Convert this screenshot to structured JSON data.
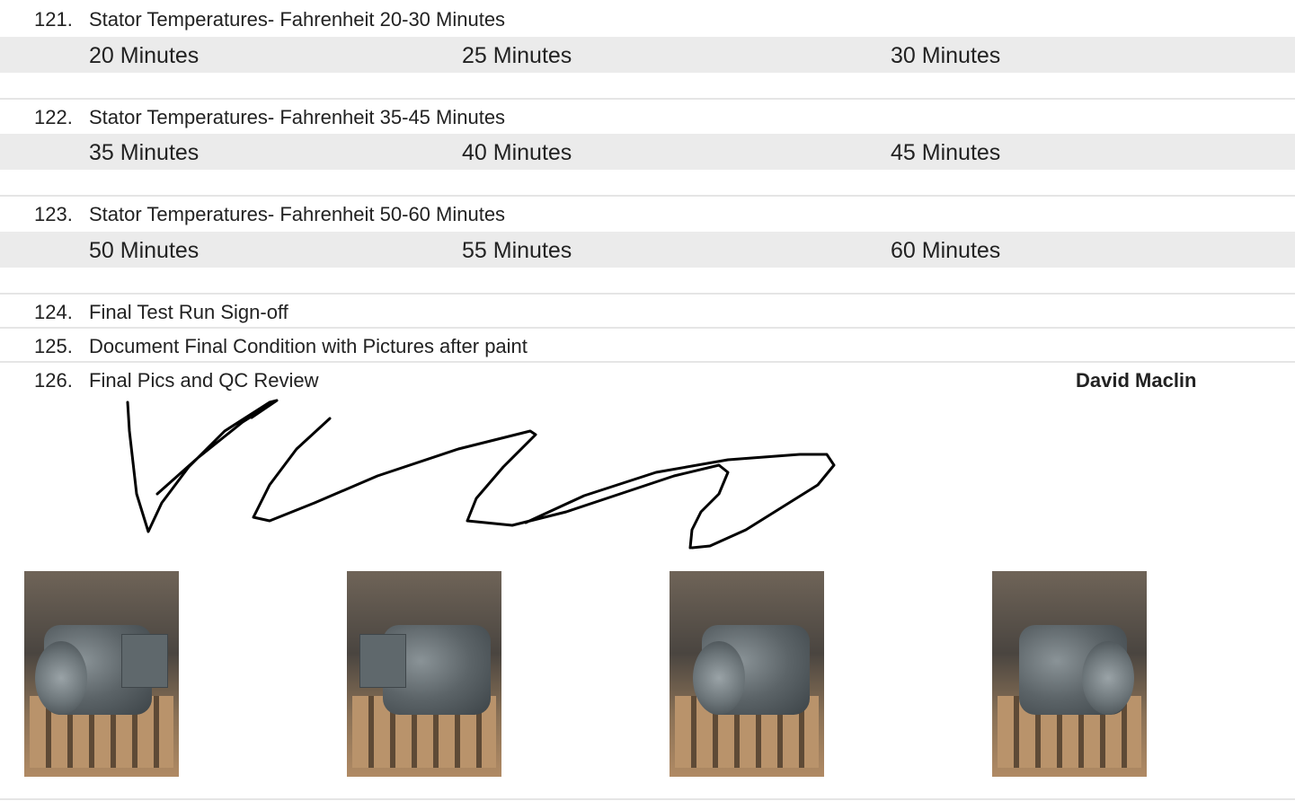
{
  "items": [
    {
      "num": "121.",
      "label": "Stator Temperatures- Fahrenheit 20-30 Minutes",
      "columns": [
        "20 Minutes",
        "25 Minutes",
        "30 Minutes"
      ]
    },
    {
      "num": "122.",
      "label": "Stator Temperatures- Fahrenheit 35-45 Minutes",
      "columns": [
        "35 Minutes",
        "40 Minutes",
        "45 Minutes"
      ]
    },
    {
      "num": "123.",
      "label": "Stator Temperatures- Fahrenheit 50-60 Minutes",
      "columns": [
        "50 Minutes",
        "55 Minutes",
        "60 Minutes"
      ]
    },
    {
      "num": "124.",
      "label": "Final Test Run Sign-off"
    },
    {
      "num": "125.",
      "label": "Document Final Condition with Pictures after paint"
    },
    {
      "num": "126.",
      "label": "Final Pics and QC Review",
      "signer": "David Maclin"
    }
  ]
}
